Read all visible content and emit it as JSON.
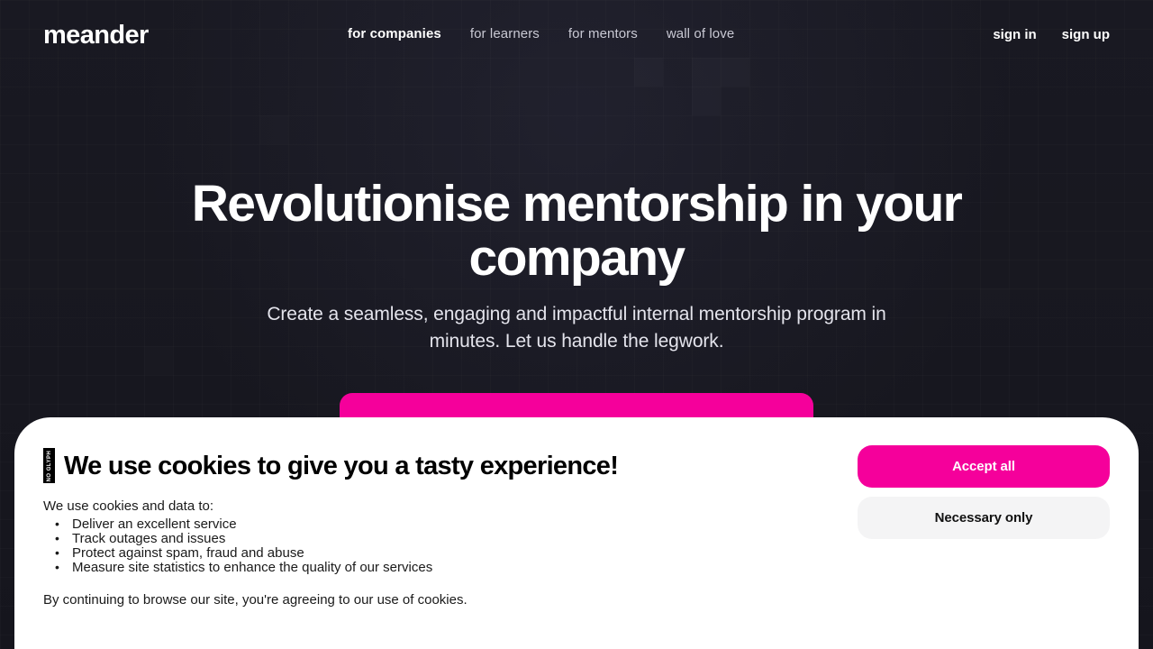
{
  "brand": {
    "logo": "meander",
    "accent_color": "#f5009b",
    "background_color": "#17171f"
  },
  "nav": {
    "links": [
      {
        "label": "for companies",
        "active": true
      },
      {
        "label": "for learners",
        "active": false
      },
      {
        "label": "for mentors",
        "active": false
      },
      {
        "label": "wall of love",
        "active": false
      }
    ],
    "auth": [
      {
        "label": "sign in"
      },
      {
        "label": "sign up"
      }
    ]
  },
  "hero": {
    "title": "Revolutionise mentorship in your company",
    "subtitle": "Create a seamless, engaging and impactful internal mentorship program in minutes. Let us handle the legwork.",
    "cta_label": ""
  },
  "cookie_banner": {
    "emoji_icon": "missing-glyph-tofu",
    "heading": "We use cookies to give you a tasty experience!",
    "intro": "We use cookies and data to:",
    "items": [
      "Deliver an excellent service",
      "Track outages and issues",
      "Protect against spam, fraud and abuse",
      "Measure site statistics to enhance the quality of our services"
    ],
    "footer": "By continuing to browse our site, you're agreeing to our use of cookies.",
    "accept_all_label": "Accept all",
    "necessary_only_label": "Necessary only"
  }
}
